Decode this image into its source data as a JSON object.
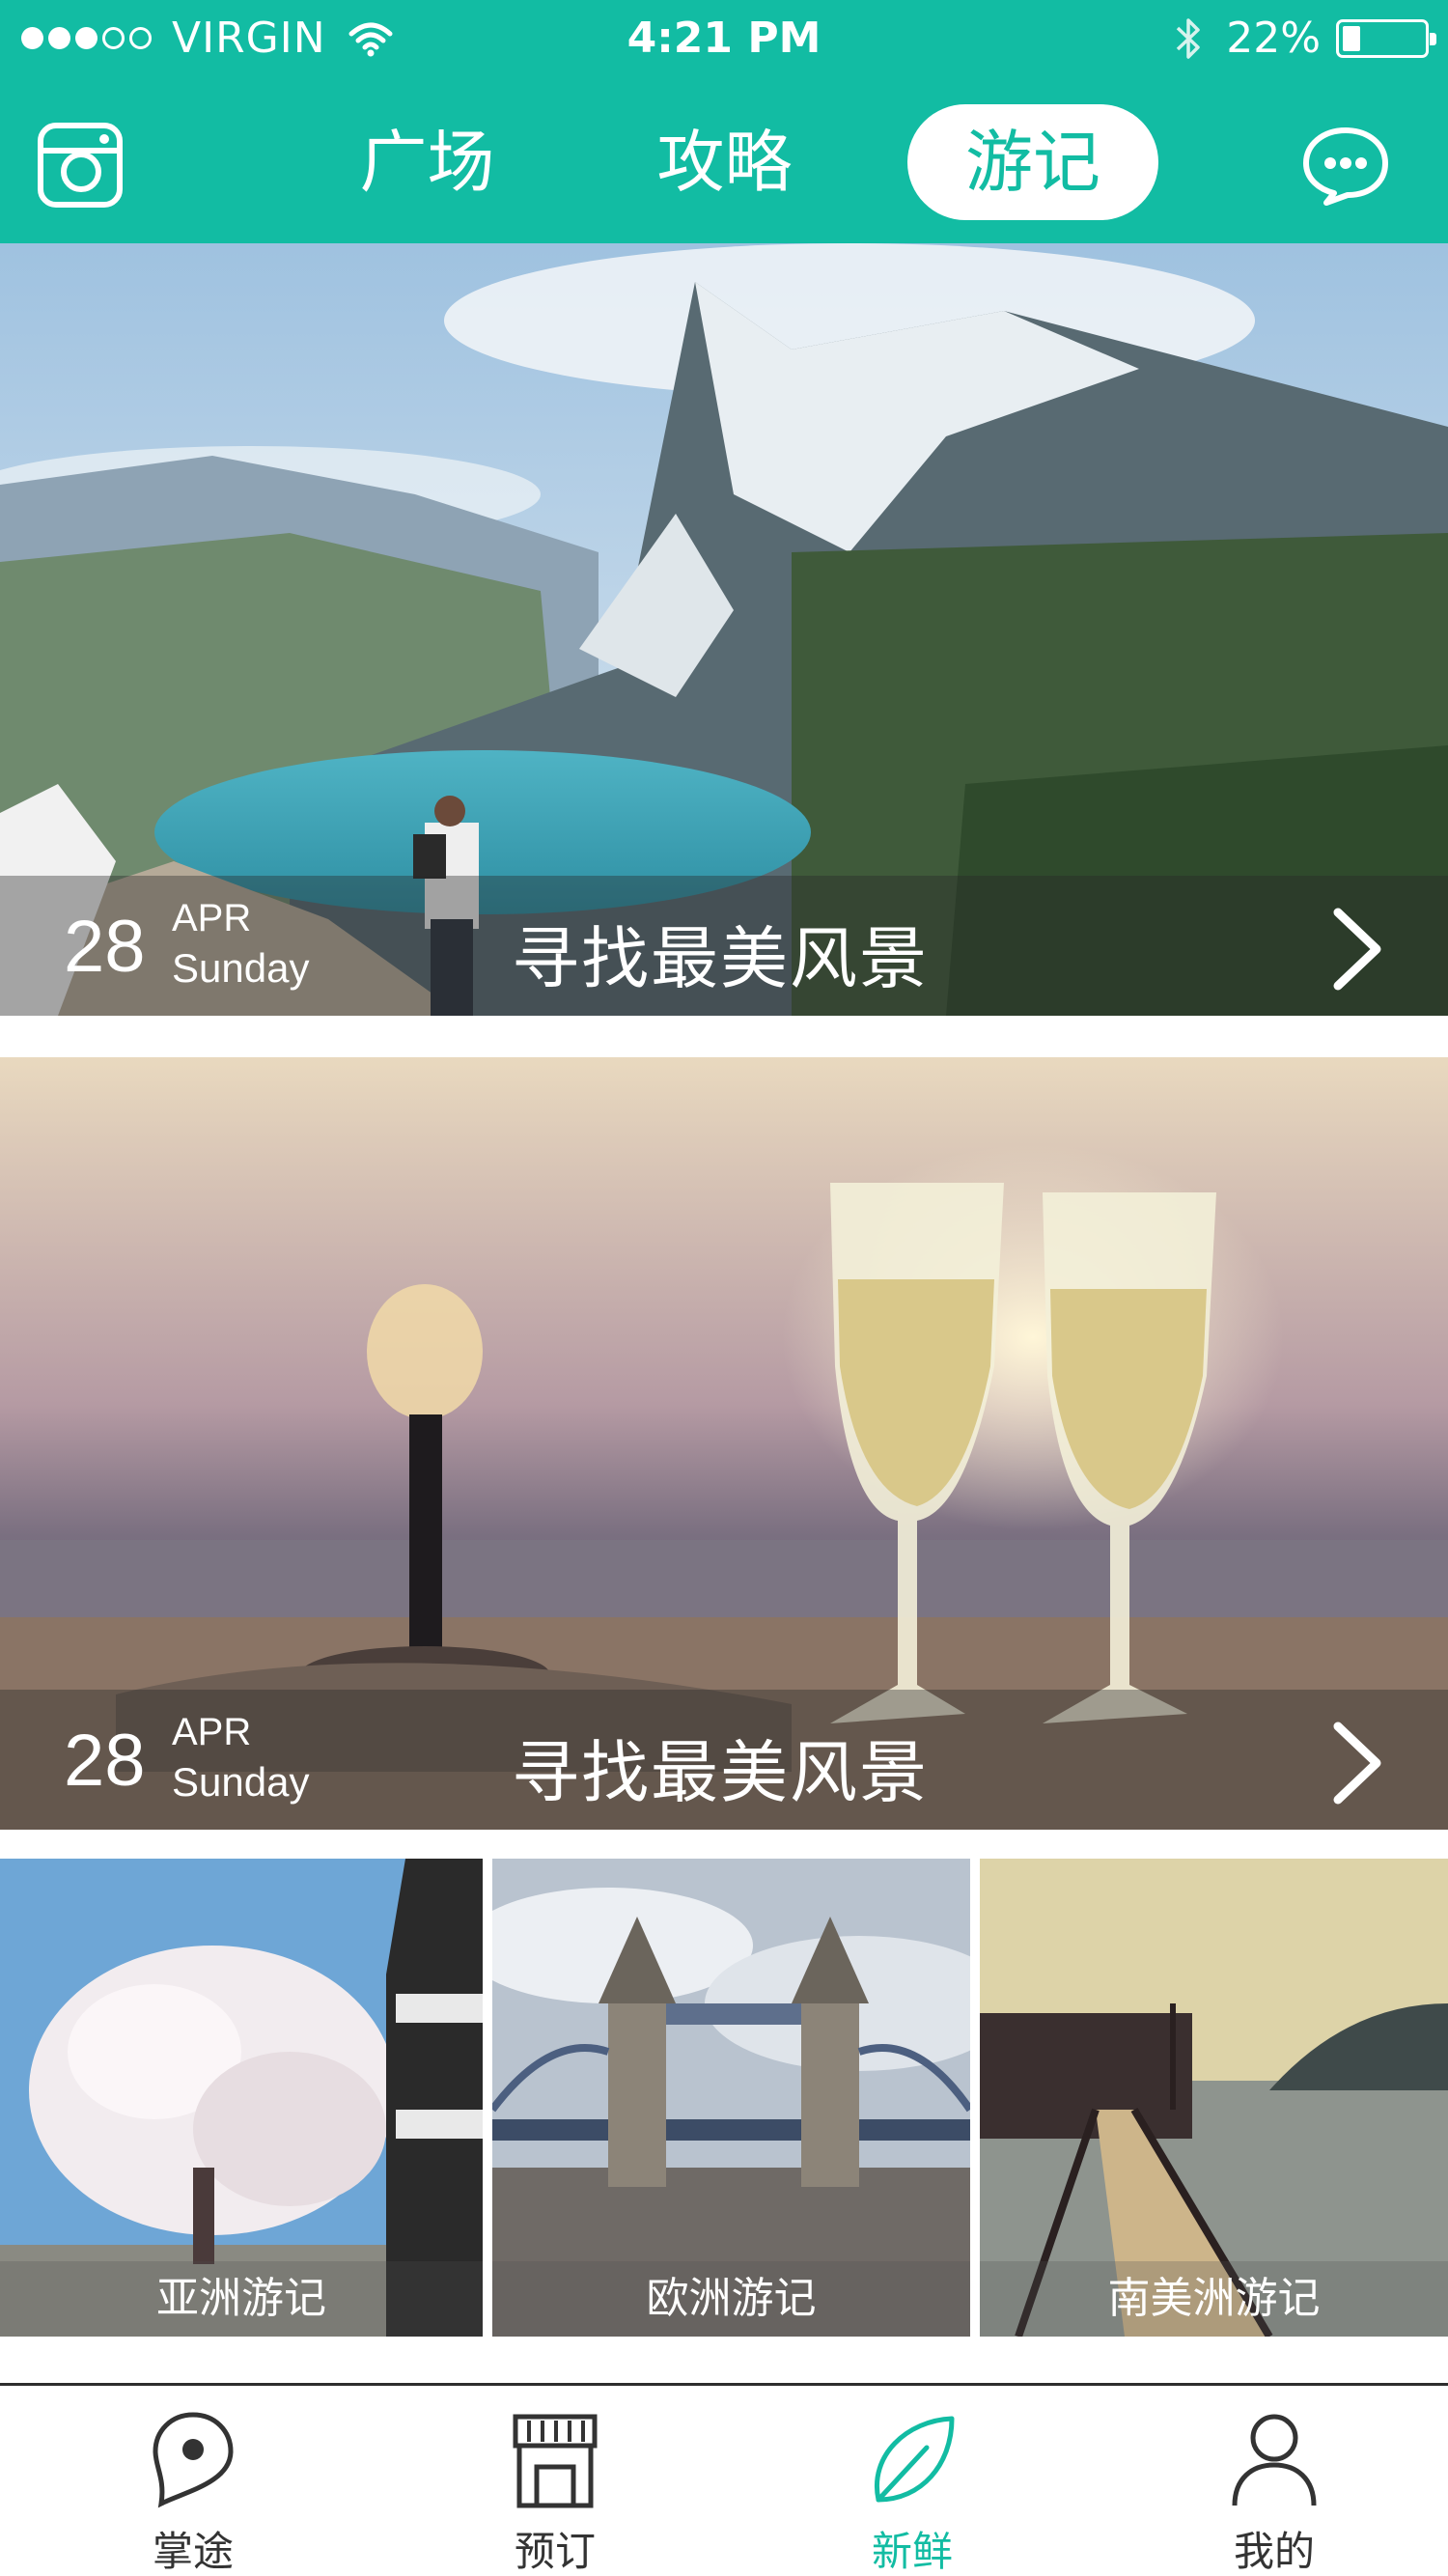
{
  "status_bar": {
    "carrier": "VIRGIN",
    "time": "4:21 PM",
    "battery_text": "22%",
    "signal_bars_filled": 3,
    "signal_bars_total": 5,
    "battery_level": 0.22
  },
  "nav": {
    "tabs": [
      {
        "label": "广场",
        "active": false
      },
      {
        "label": "攻略",
        "active": false
      },
      {
        "label": "游记",
        "active": true
      }
    ],
    "left_icon": "camera-icon",
    "right_icon": "chat-bubble-icon"
  },
  "features": [
    {
      "day": "28",
      "month": "APR",
      "weekday": "Sunday",
      "title": "寻找最美风景",
      "image": "mountain-lake-photo"
    },
    {
      "day": "28",
      "month": "APR",
      "weekday": "Sunday",
      "title": "寻找最美风景",
      "image": "champagne-sunset-photo"
    }
  ],
  "regions": [
    {
      "label": "亚洲游记",
      "image": "cherry-blossom-photo"
    },
    {
      "label": "欧洲游记",
      "image": "tower-bridge-photo"
    },
    {
      "label": "南美洲游记",
      "image": "pier-bay-photo"
    }
  ],
  "tabbar": {
    "items": [
      {
        "label": "掌途",
        "icon": "location-pin-icon",
        "active": false
      },
      {
        "label": "预订",
        "icon": "storefront-icon",
        "active": false
      },
      {
        "label": "新鲜",
        "icon": "leaf-icon",
        "active": true
      },
      {
        "label": "我的",
        "icon": "person-icon",
        "active": false
      }
    ]
  },
  "colors": {
    "accent": "#12bca3",
    "text_dark": "#333333",
    "white": "#ffffff"
  }
}
